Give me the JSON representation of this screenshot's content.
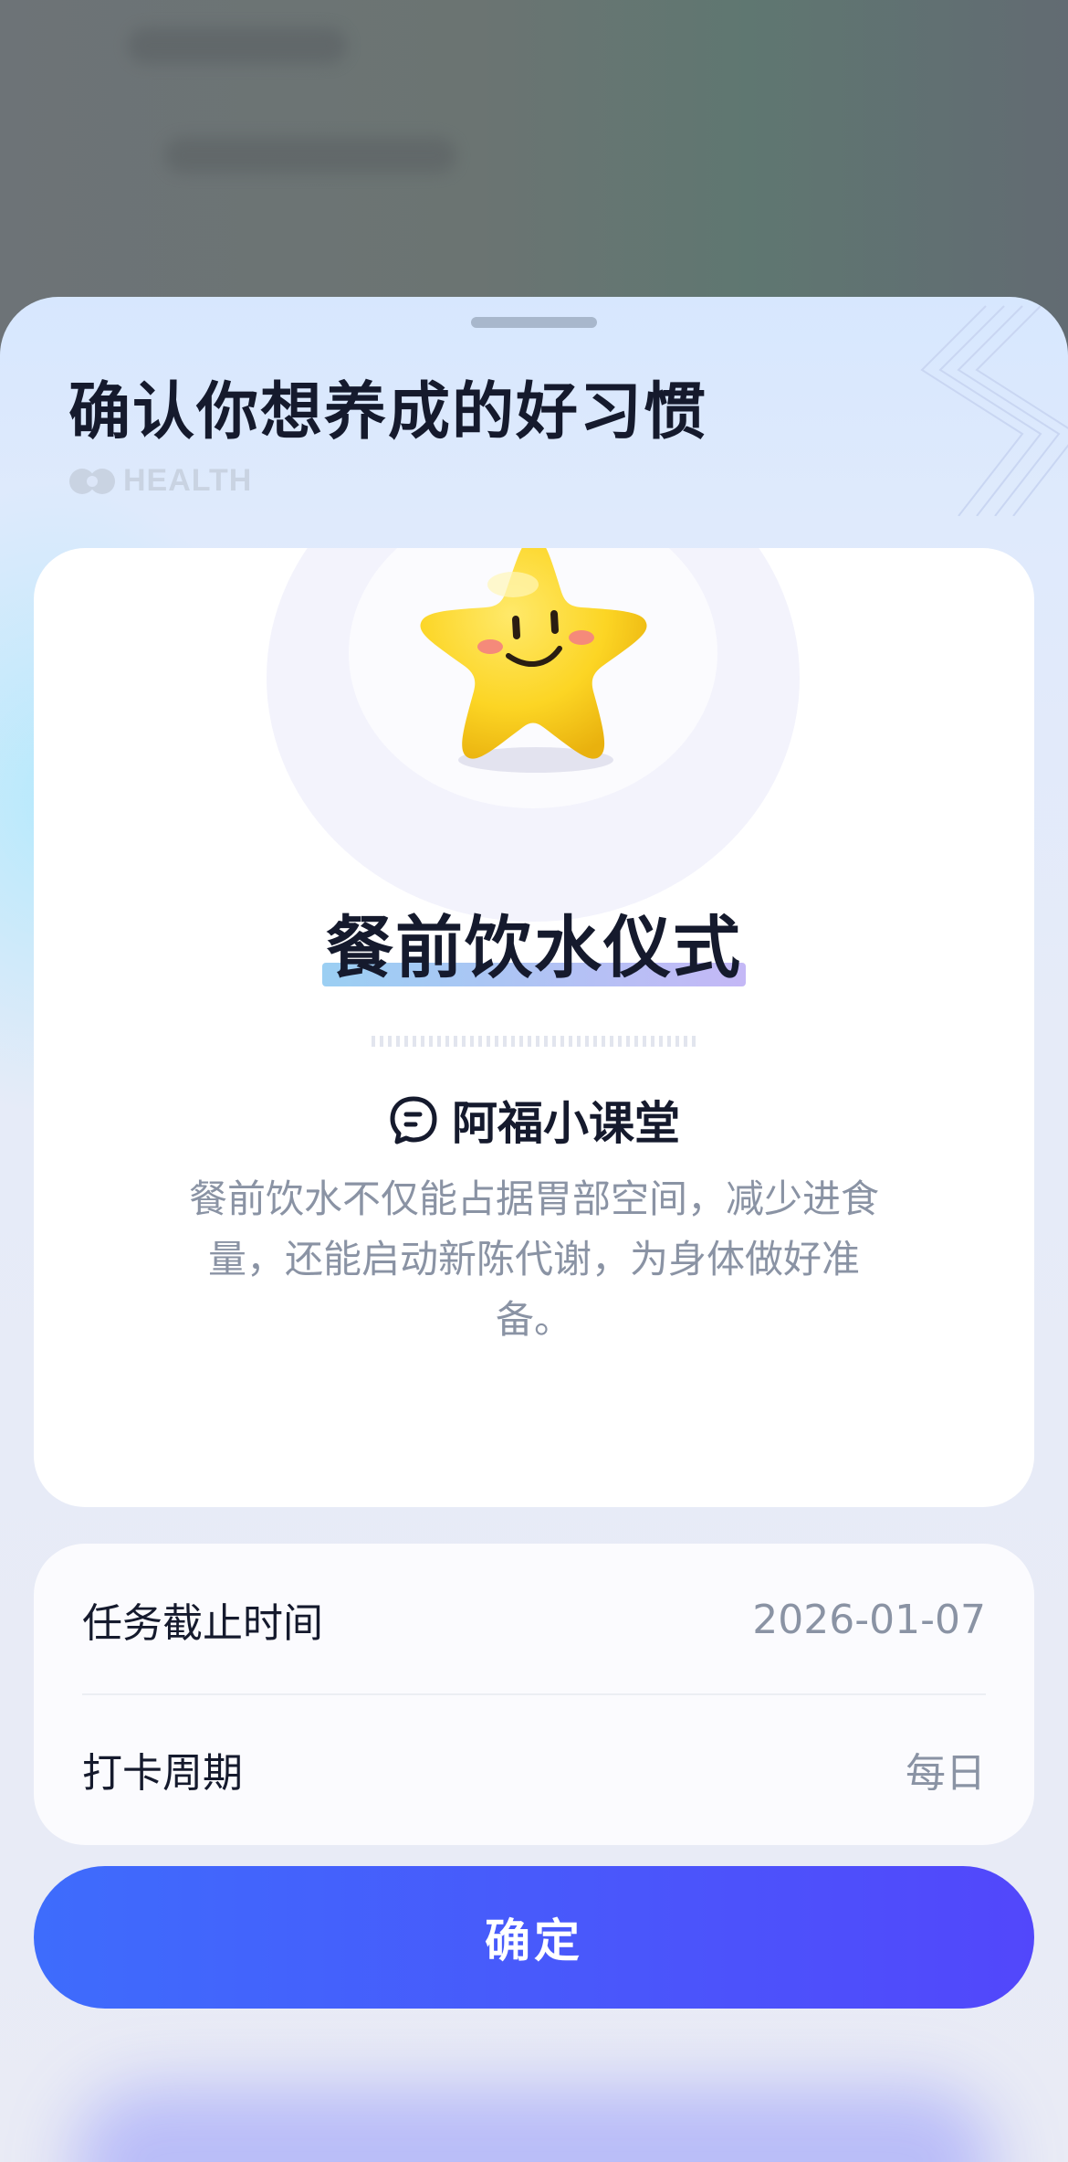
{
  "sheet": {
    "title": "确认你想养成的好习惯",
    "brand_text": "HEALTH"
  },
  "habit": {
    "name": "餐前饮水仪式",
    "course_title": "阿福小课堂",
    "description": "餐前饮水不仅能占据胃部空间，减少进食量，还能启动新陈代谢，为身体做好准备。"
  },
  "info": {
    "rows": [
      {
        "label": "任务截止时间",
        "value": "2026-01-07"
      },
      {
        "label": "打卡周期",
        "value": "每日"
      }
    ]
  },
  "actions": {
    "confirm_label": "确定"
  },
  "colors": {
    "primary_button": "#4a56fb",
    "title_text": "#151a2d",
    "secondary_text": "#8a93a4",
    "star": "#fcd524"
  },
  "icons": {
    "brand": "health-logo-icon",
    "course": "chat-bubble-icon",
    "mascot": "smiling-star-mascot"
  }
}
